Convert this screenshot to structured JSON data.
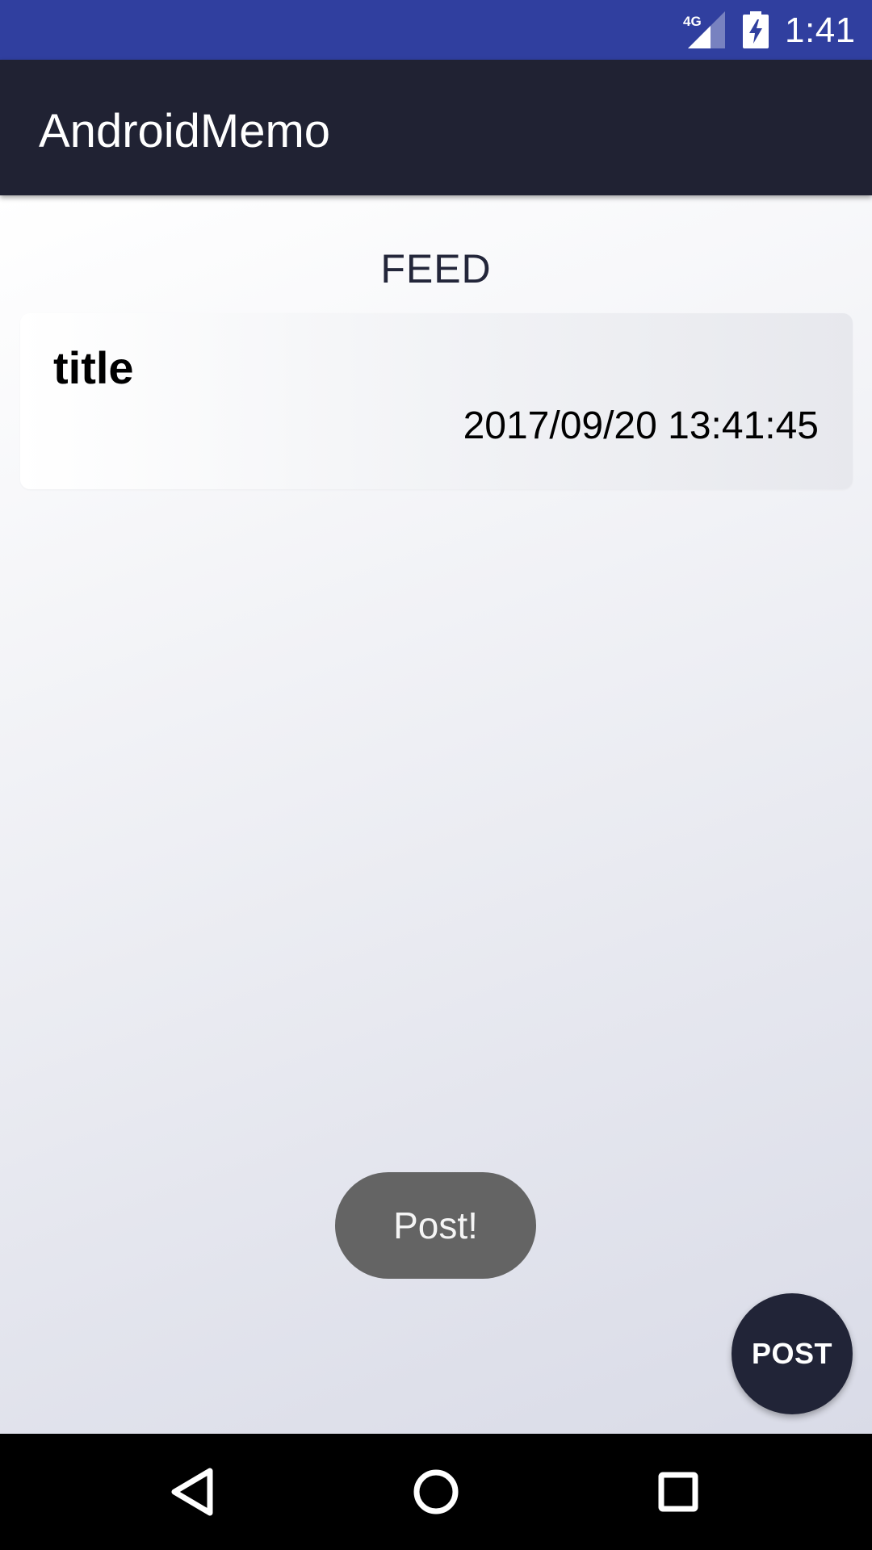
{
  "status_bar": {
    "network_icon": "signal-4g-icon",
    "battery_icon": "battery-charging-icon",
    "network_label": "4G",
    "time": "1:41",
    "color": "#303f9f"
  },
  "app_bar": {
    "title": "AndroidMemo",
    "color": "#202233"
  },
  "feed": {
    "heading": "FEED",
    "items": [
      {
        "title": "title",
        "date": "2017/09/20 13:41:45"
      }
    ]
  },
  "toast": {
    "message": "Post!"
  },
  "fab": {
    "label": "POST",
    "color": "#212437"
  },
  "nav_bar": {
    "back_icon": "back-triangle-icon",
    "home_icon": "home-circle-icon",
    "recents_icon": "recents-square-icon"
  }
}
